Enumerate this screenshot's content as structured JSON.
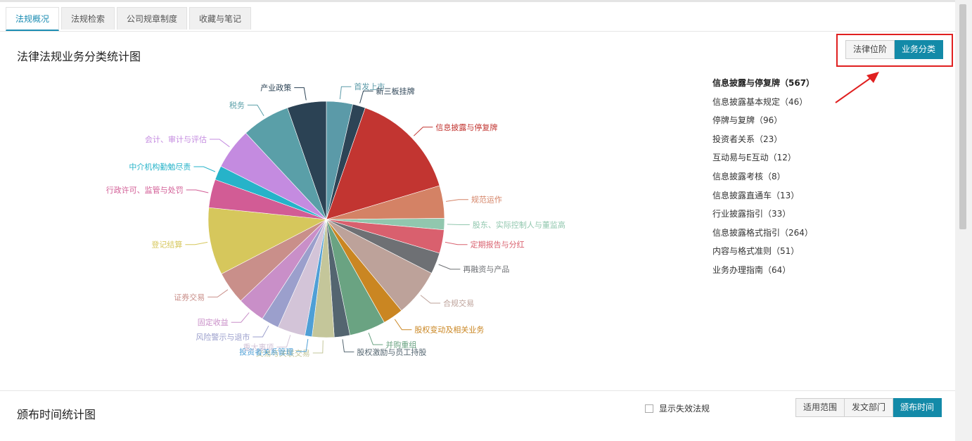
{
  "tabs": [
    "法规概况",
    "法规检索",
    "公司规章制度",
    "收藏与笔记"
  ],
  "section1": {
    "title": "法律法规业务分类统计图",
    "buttons": [
      "法律位阶",
      "业务分类"
    ]
  },
  "legend": [
    "信息披露与停复牌（567）",
    "信息披露基本规定（46）",
    "停牌与复牌（96）",
    "投资者关系（23）",
    "互动易与E互动（12）",
    "信息披露考核（8）",
    "信息披露直通车（13）",
    "行业披露指引（33）",
    "信息披露格式指引（264）",
    "内容与格式准则（51）",
    "业务办理指南（64）"
  ],
  "chart_data": {
    "type": "pie",
    "slices": [
      {
        "label": "首发上市",
        "value": 3.7,
        "color": "#5b9aa8"
      },
      {
        "label": "新三板挂牌",
        "value": 1.8,
        "color": "#2d4456"
      },
      {
        "label": "信息披露与停复牌",
        "value": 15.5,
        "color": "#c23531"
      },
      {
        "label": "规范运作",
        "value": 4.6,
        "color": "#d48265"
      },
      {
        "label": "股东、实际控制人与董监高",
        "value": 1.6,
        "color": "#91c7ae"
      },
      {
        "label": "定期报告与分红",
        "value": 3.3,
        "color": "#d9606e"
      },
      {
        "label": "再融资与产品",
        "value": 3.0,
        "color": "#6e7074"
      },
      {
        "label": "合规交易",
        "value": 6.7,
        "color": "#bda29a"
      },
      {
        "label": "股权变动及相关业务",
        "value": 2.9,
        "color": "#ca8622"
      },
      {
        "label": "并购重组",
        "value": 5.1,
        "color": "#6aa382"
      },
      {
        "label": "股权激励与员工持股",
        "value": 2.2,
        "color": "#546570"
      },
      {
        "label": "交易与关联交易",
        "value": 3.1,
        "color": "#c4c69a"
      },
      {
        "label": "投资者关系管理",
        "value": 1.0,
        "color": "#4f9fd6"
      },
      {
        "label": "重大事项",
        "value": 3.9,
        "color": "#d3c4d8"
      },
      {
        "label": "风险警示与退市",
        "value": 2.5,
        "color": "#9b9fcc"
      },
      {
        "label": "固定收益",
        "value": 3.9,
        "color": "#c98fc8"
      },
      {
        "label": "证券交易",
        "value": 4.6,
        "color": "#c98f8a"
      },
      {
        "label": "登记结算",
        "value": 9.5,
        "color": "#d6c75c"
      },
      {
        "label": "行政许可、监管与处罚",
        "value": 4.0,
        "color": "#d25c95"
      },
      {
        "label": "中介机构勤勉尽责",
        "value": 2.0,
        "color": "#26b3c9"
      },
      {
        "label": "会计、审计与评估",
        "value": 5.8,
        "color": "#c48be0"
      },
      {
        "label": "税务",
        "value": 6.8,
        "color": "#5a9fa8"
      },
      {
        "label": "产业政策",
        "value": 5.5,
        "color": "#2b4254"
      }
    ]
  },
  "section2": {
    "title": "颁布时间统计图",
    "checkbox_label": "显示失效法规",
    "buttons": [
      "适用范围",
      "发文部门",
      "颁布时间"
    ]
  }
}
